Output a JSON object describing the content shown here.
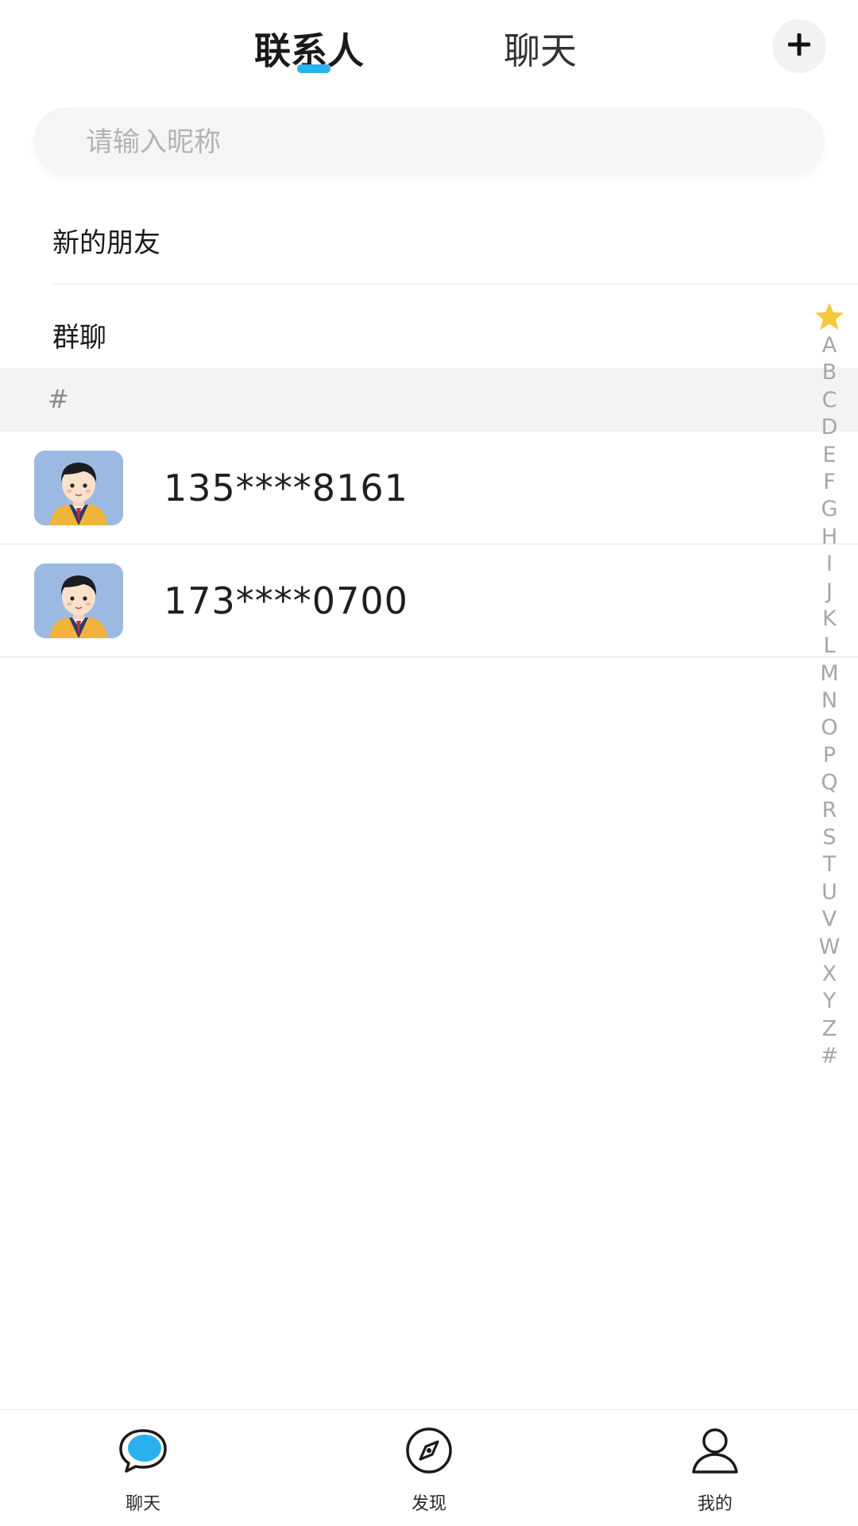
{
  "header": {
    "tabs": [
      {
        "label": "联系人",
        "active": true
      },
      {
        "label": "聊天",
        "active": false
      }
    ],
    "add_icon": "plus-icon",
    "accent_color": "#2bb3ea"
  },
  "search": {
    "placeholder": "请输入昵称",
    "value": ""
  },
  "quick_items": [
    {
      "label": "新的朋友"
    },
    {
      "label": "群聊"
    }
  ],
  "section": {
    "header": "#"
  },
  "contacts": [
    {
      "name": "135****8161",
      "avatar": "boy-avatar-icon"
    },
    {
      "name": "173****0700",
      "avatar": "boy-avatar-icon"
    }
  ],
  "alphabet_index": {
    "top_icon": "star-icon",
    "letters": [
      "A",
      "B",
      "C",
      "D",
      "E",
      "F",
      "G",
      "H",
      "I",
      "J",
      "K",
      "L",
      "M",
      "N",
      "O",
      "P",
      "Q",
      "R",
      "S",
      "T",
      "U",
      "V",
      "W",
      "X",
      "Y",
      "Z",
      "#"
    ]
  },
  "bottom_nav": [
    {
      "label": "聊天",
      "icon": "chat-bubble-icon"
    },
    {
      "label": "发现",
      "icon": "compass-icon"
    },
    {
      "label": "我的",
      "icon": "person-icon"
    }
  ]
}
